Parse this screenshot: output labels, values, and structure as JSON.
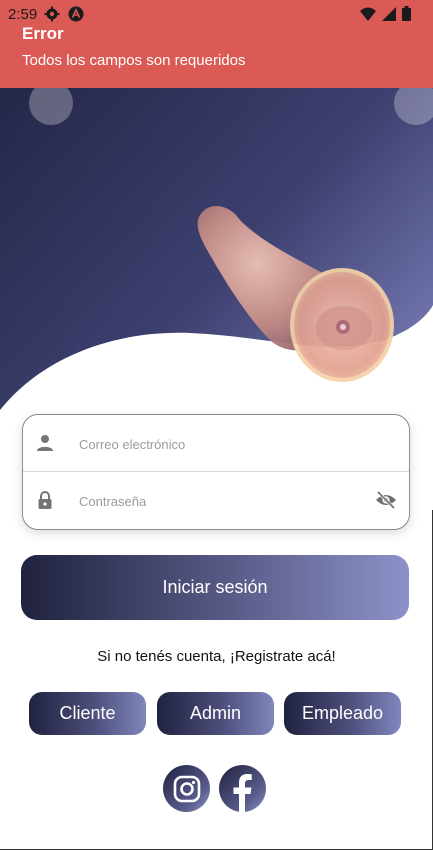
{
  "status_bar": {
    "time": "2:59"
  },
  "toast": {
    "title": "Error",
    "message": "Todos los campos son requeridos",
    "color": "#dc5a55"
  },
  "login_form": {
    "email_placeholder": "Correo electrónico",
    "password_placeholder": "Contraseña"
  },
  "login_button": {
    "label": "Iniciar sesión"
  },
  "signup": {
    "text": "Si no tenés cuenta, ¡Registrate acá!"
  },
  "role_buttons": [
    {
      "label": "Cliente"
    },
    {
      "label": "Admin"
    },
    {
      "label": "Empleado"
    }
  ],
  "social": [
    {
      "icon": "instagram-icon"
    },
    {
      "icon": "facebook-icon"
    }
  ],
  "colors": {
    "brand_dark": "#20223f",
    "brand_light": "#8c92c8",
    "error": "#dc5a55"
  }
}
